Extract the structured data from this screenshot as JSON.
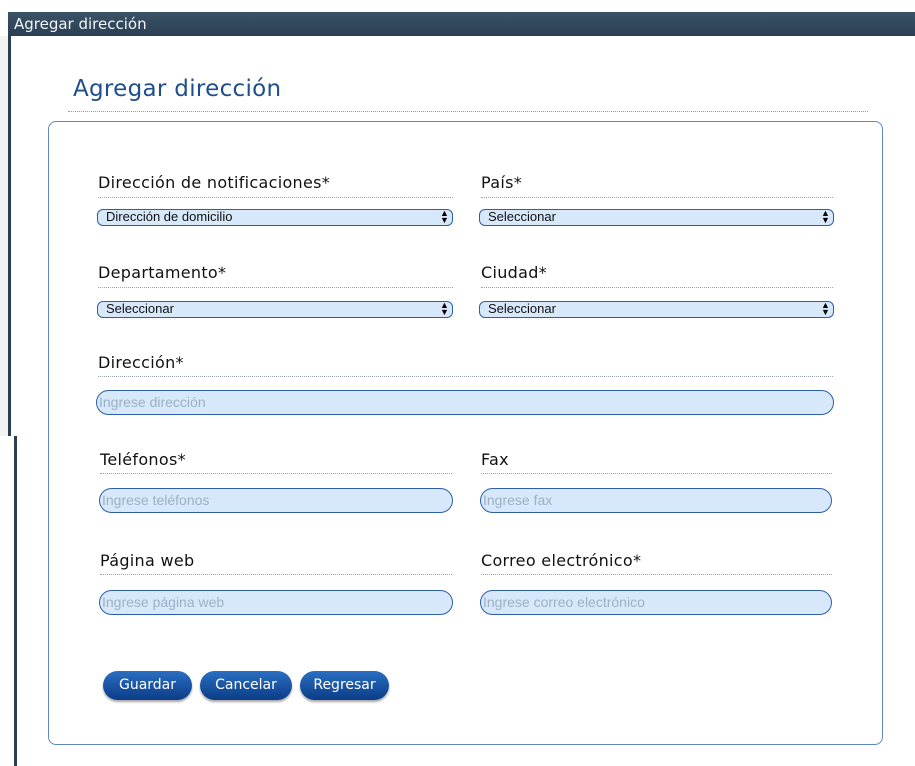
{
  "window": {
    "title": "Agregar dirección"
  },
  "page": {
    "heading": "Agregar dirección"
  },
  "form": {
    "notification_address": {
      "label": "Dirección de notificaciones*",
      "value": "Dirección de domicilio"
    },
    "country": {
      "label": "País*",
      "value": "Seleccionar"
    },
    "department": {
      "label": "Departamento*",
      "value": "Seleccionar"
    },
    "city": {
      "label": "Ciudad*",
      "value": "Seleccionar"
    },
    "address": {
      "label": "Dirección*",
      "placeholder": "Ingrese dirección"
    },
    "phones": {
      "label": "Teléfonos*",
      "placeholder": "Ingrese teléfonos"
    },
    "fax": {
      "label": "Fax",
      "placeholder": "Ingrese fax"
    },
    "website": {
      "label": "Página web",
      "placeholder": "Ingrese página web"
    },
    "email": {
      "label": "Correo electrónico*",
      "placeholder": "Ingrese correo electrónico"
    }
  },
  "buttons": {
    "save": "Guardar",
    "cancel": "Cancelar",
    "back": "Regresar"
  },
  "icons": {
    "select_arrow": "up-down-arrows-icon"
  },
  "colors": {
    "titlebar": "#2b3f52",
    "heading": "#1f4e8c",
    "field_bg": "#d7e8fb",
    "button": "#0b3c86"
  }
}
